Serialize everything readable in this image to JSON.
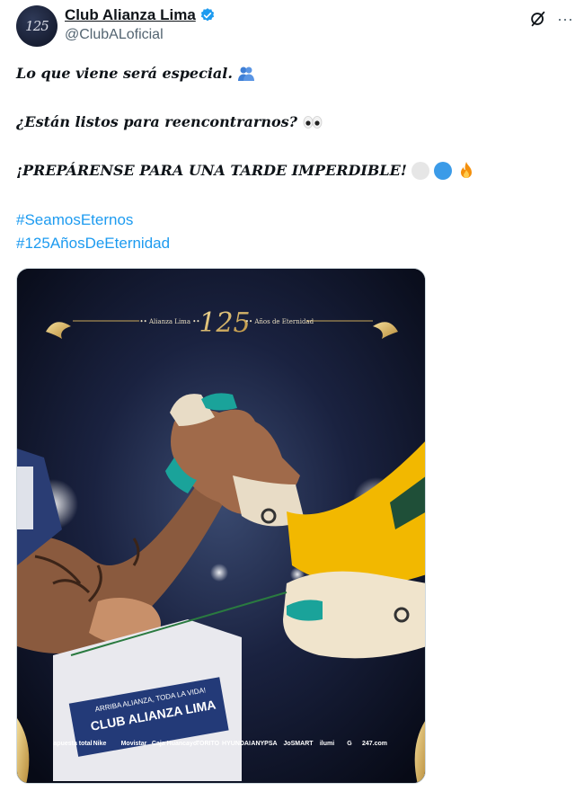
{
  "account": {
    "display_name": "Club Alianza Lima",
    "handle": "@ClubALoficial",
    "avatar_text": "125"
  },
  "tweet": {
    "line1": "Lo que viene será especial.",
    "line2": "¿Están listos para reencontrarnos?",
    "line3": "¡PREPÁRENSE PARA UNA TARDE IMPERDIBLE!",
    "hashtags": [
      "#SeamosEternos",
      "#125AñosDeEternidad"
    ]
  },
  "media": {
    "banner_left": "•• Alianza Lima ••",
    "banner_number": "125",
    "banner_right": "•• Años de Eternidad",
    "pennant_top": "ARRIBA ALIANZA, TODA LA VIDA!",
    "pennant_main": "CLUB ALIANZA LIMA",
    "sponsors": [
      "apuesta total",
      "Nike",
      "Movistar",
      "Caja Huancayo",
      "TORITO",
      "HYUNDAI",
      "ANYPSA",
      "JoSMART",
      "ilumi",
      "G",
      "247.com"
    ]
  },
  "icons": {
    "verified": "verified-badge-icon",
    "grok": "grok-icon",
    "more": "more-icon"
  },
  "colors": {
    "link": "#1d9bf0",
    "verified": "#1d9bf0",
    "text": "#0f1419",
    "secondary": "#536471",
    "gold": "#c9a85a",
    "glove_teal": "#1aa39a",
    "jersey_yellow": "#f2b800"
  }
}
